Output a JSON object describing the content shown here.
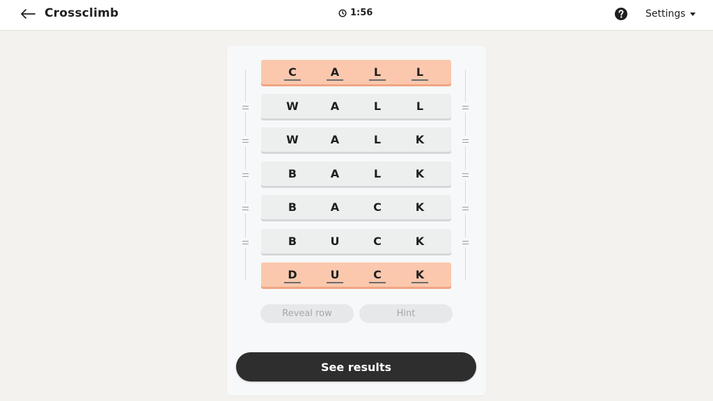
{
  "header": {
    "title": "Crossclimb",
    "timer": "1:56",
    "settings_label": "Settings",
    "back_icon": "arrow-left-icon",
    "help_icon": "question-circle-icon",
    "timer_icon": "clock-icon"
  },
  "board": {
    "rows": [
      {
        "letters": [
          "C",
          "A",
          "L",
          "L"
        ],
        "state": "locked"
      },
      {
        "letters": [
          "W",
          "A",
          "L",
          "L"
        ],
        "state": "plain"
      },
      {
        "letters": [
          "W",
          "A",
          "L",
          "K"
        ],
        "state": "plain"
      },
      {
        "letters": [
          "B",
          "A",
          "L",
          "K"
        ],
        "state": "plain"
      },
      {
        "letters": [
          "B",
          "A",
          "C",
          "K"
        ],
        "state": "plain"
      },
      {
        "letters": [
          "B",
          "U",
          "C",
          "K"
        ],
        "state": "plain"
      },
      {
        "letters": [
          "D",
          "U",
          "C",
          "K"
        ],
        "state": "locked"
      }
    ],
    "reveal_row_label": "Reveal row",
    "hint_label": "Hint",
    "see_results_label": "See results"
  },
  "colors": {
    "locked_row": "#fbc8ad",
    "plain_row": "#edeeee",
    "primary_button": "#2e2e2e",
    "disabled_button": "#e7e8e9",
    "background": "#f3f2ee"
  }
}
